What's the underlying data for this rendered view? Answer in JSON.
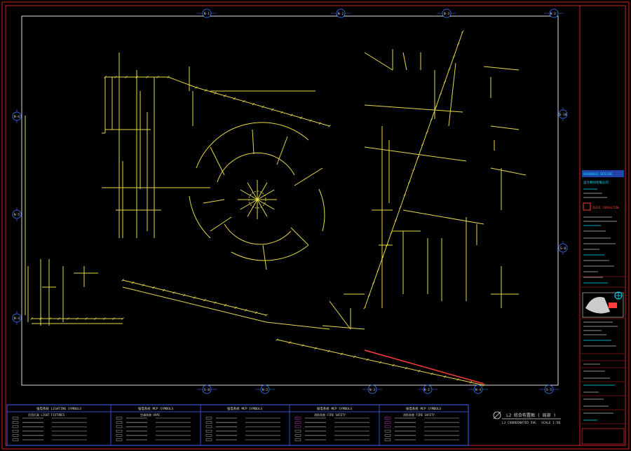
{
  "grid_top": [
    "N-1",
    "N-2",
    "N-3",
    "N-3'"
  ],
  "grid_bottom": [
    "S-0",
    "N-2",
    "N-3",
    "N-3'",
    "N-4",
    "S-5"
  ],
  "grid_left": [
    "N-6",
    "N-5",
    "N-4"
  ],
  "grid_right": [
    "S-10",
    "S-8"
  ],
  "drawing_title": "L2 综合布置图 ( 局部 )",
  "drawing_subtitle": "L2 COORDINATED SVG",
  "drawing_scale": "SCALE 1:50",
  "legend_headers": [
    "强电系统 LIGHTING SYMBOLS",
    "强电系统 MEP SYMBOLS",
    "强电系统 MEP SYMBOLS",
    "弱电系统 MEP SYMBOLS",
    "弱电系统 MEP SYMBOLS"
  ],
  "legend_subheaders": [
    "吊顶灯具 LIGHT FIXTURES",
    "空调系统 HVAC",
    "",
    "消防系统 FIRE SAFETY",
    "消防系统 FIRE SAFETY"
  ],
  "title_block": {
    "company": "SHANGHAI DESIGN",
    "firm_cn": "设计顾问有限公司",
    "stamp_text": "ZHIXI CONSULTING"
  },
  "colors": {
    "frame": "#cc2222",
    "lines": "#e6d84a",
    "grid": "#3a7bff",
    "legend": "#4060ff",
    "accent": "#ff3b3b"
  }
}
